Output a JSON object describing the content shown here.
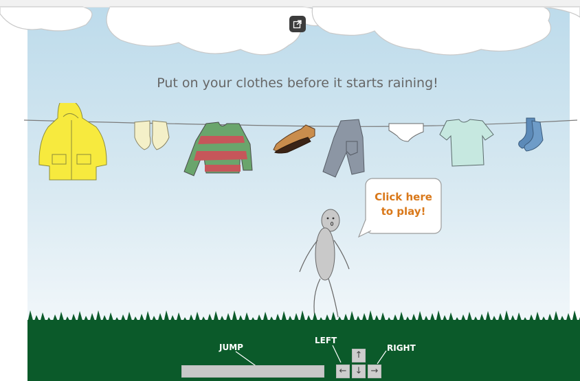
{
  "game": {
    "instruction": "Put on your clothes before it starts raining!",
    "play_bubble": {
      "line1": "Click here",
      "line2": "to play!"
    },
    "clothes": [
      "raincoat",
      "gloves",
      "sweater",
      "shoes",
      "jeans",
      "underpants",
      "t-shirt",
      "socks"
    ]
  },
  "controls": {
    "jump_label": "JUMP",
    "left_label": "LEFT",
    "right_label": "RIGHT",
    "up_key": "↑",
    "left_key": "←",
    "down_key": "↓",
    "right_key": "→"
  },
  "colors": {
    "sky": "#bddbeb",
    "grass": "#0b5a2a",
    "prompt_text": "#666666",
    "bubble_text": "#d9781a"
  },
  "icons": {
    "popout": "external-link-icon"
  }
}
